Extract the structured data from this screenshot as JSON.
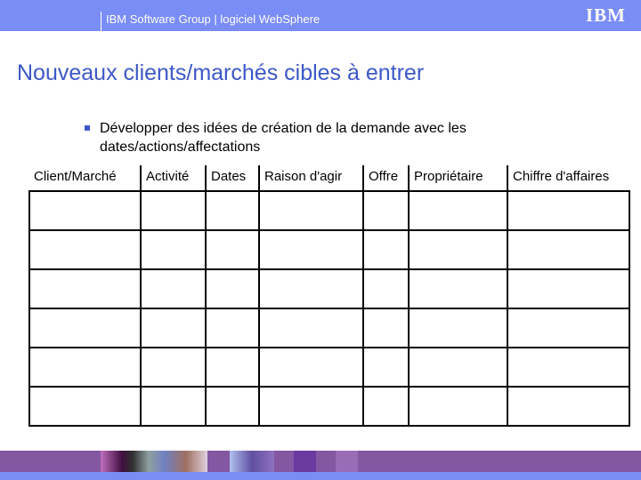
{
  "header": {
    "title": "IBM Software Group | logiciel WebSphere",
    "logo": "IBM"
  },
  "slide": {
    "title": "Nouveaux clients/marchés cibles à entrer",
    "bullet": "Développer des idées de création de la demande avec les dates/actions/affectations"
  },
  "table": {
    "columns": [
      "Client/Marché",
      "Activité",
      "Dates",
      "Raison d'agir",
      "Offre",
      "Propriétaire",
      "Chiffre d'affaires"
    ],
    "row_count": 6
  },
  "colors": {
    "header": "#7a8cf5",
    "title": "#3d58c8",
    "footer": "#8457a2"
  }
}
